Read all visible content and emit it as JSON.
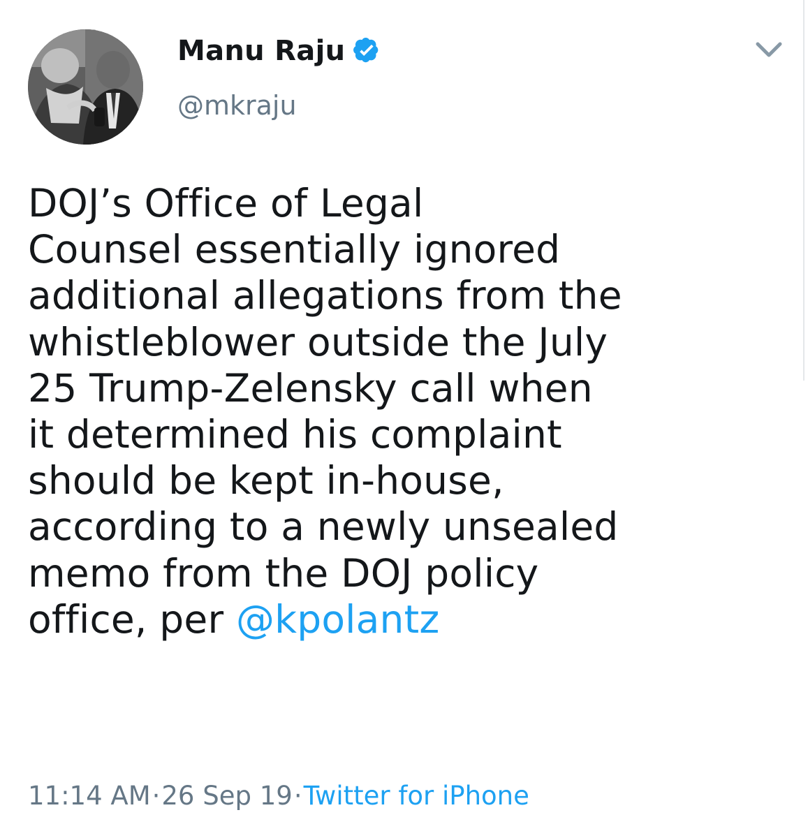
{
  "author": {
    "display_name": "Manu Raju",
    "handle": "@mkraju",
    "verified_icon": "verified-badge-icon",
    "avatar_icon": "avatar"
  },
  "tweet": {
    "lines": [
      "DOJ’s Office of Legal",
      "Counsel essentially ignored",
      "additional allegations from the",
      "whistleblower outside the July",
      "25 Trump-Zelensky call when",
      "it determined his complaint",
      "should be kept in-house,",
      "according to a newly unsealed",
      "memo from the DOJ policy"
    ],
    "last_line_prefix": "office, per ",
    "mention": "@kpolantz"
  },
  "meta": {
    "time": "11:14 AM",
    "separator": "·",
    "date": "26 Sep 19",
    "source": "Twitter for iPhone"
  },
  "colors": {
    "text": "#14171a",
    "muted": "#657786",
    "link": "#1da1f2"
  },
  "icons": {
    "menu": "chevron-down-icon"
  }
}
